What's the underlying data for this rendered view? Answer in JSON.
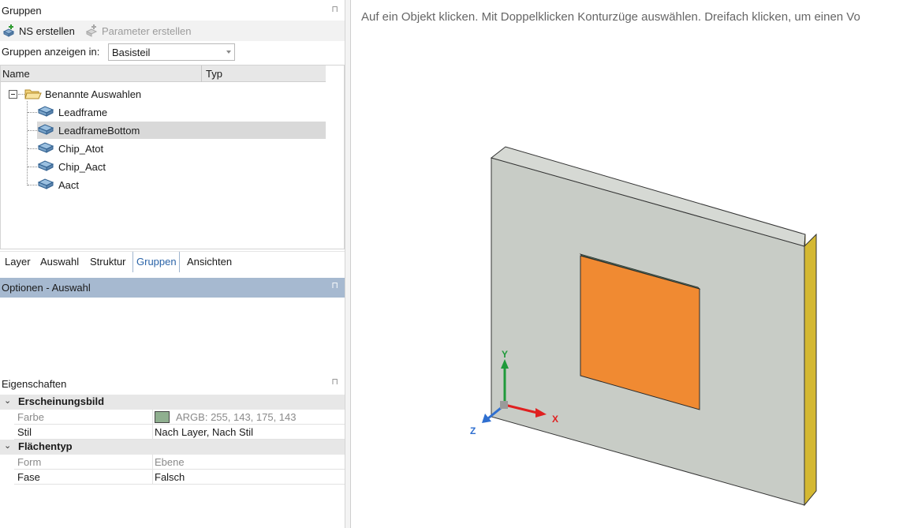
{
  "groups": {
    "title": "Gruppen",
    "toolbar": {
      "ns_create": "NS erstellen",
      "param_create": "Parameter erstellen"
    },
    "show_in_label": "Gruppen anzeigen in:",
    "show_in_value": "Basisteil",
    "tree": {
      "col_name": "Name",
      "col_type": "Typ",
      "root_label": "Benannte Auswahlen",
      "items": [
        {
          "label": "Leadframe",
          "selected": false
        },
        {
          "label": "LeadframeBottom",
          "selected": true
        },
        {
          "label": "Chip_Atot",
          "selected": false
        },
        {
          "label": "Chip_Aact",
          "selected": false
        },
        {
          "label": "Aact",
          "selected": false
        }
      ]
    },
    "tabs": [
      {
        "label": "Layer",
        "active": false
      },
      {
        "label": "Auswahl",
        "active": false
      },
      {
        "label": "Struktur",
        "active": false
      },
      {
        "label": "Gruppen",
        "active": true
      },
      {
        "label": "Ansichten",
        "active": false
      }
    ]
  },
  "options": {
    "title": "Optionen - Auswahl"
  },
  "properties": {
    "title": "Eigenschaften",
    "categories": [
      {
        "label": "Erscheinungsbild",
        "rows": [
          {
            "key": "Farbe",
            "value": "ARGB: 255, 143, 175, 143",
            "muted": true,
            "swatch": "#8faf8f"
          },
          {
            "key": "Stil",
            "value": "Nach Layer, Nach Stil",
            "muted": false
          }
        ]
      },
      {
        "label": "Flächentyp",
        "rows": [
          {
            "key": "Form",
            "value": "Ebene",
            "muted": true
          },
          {
            "key": "Fase",
            "value": "Falsch",
            "muted": false
          }
        ]
      }
    ]
  },
  "viewport": {
    "hint": "Auf ein Objekt klicken. Mit Doppelklicken Konturzüge auswählen. Dreifach klicken, um einen Vo",
    "axes": {
      "x": "X",
      "y": "Y",
      "z": "Z"
    },
    "colors": {
      "plate": "#c8ccc6",
      "plate_top": "#d6d9d4",
      "plate_edge": "#d4b832",
      "chip": "#f08a32",
      "chip_edge": "#5a8a6e",
      "axis_x": "#e02020",
      "axis_y": "#1f9a3a",
      "axis_z": "#2f6fd0"
    }
  }
}
